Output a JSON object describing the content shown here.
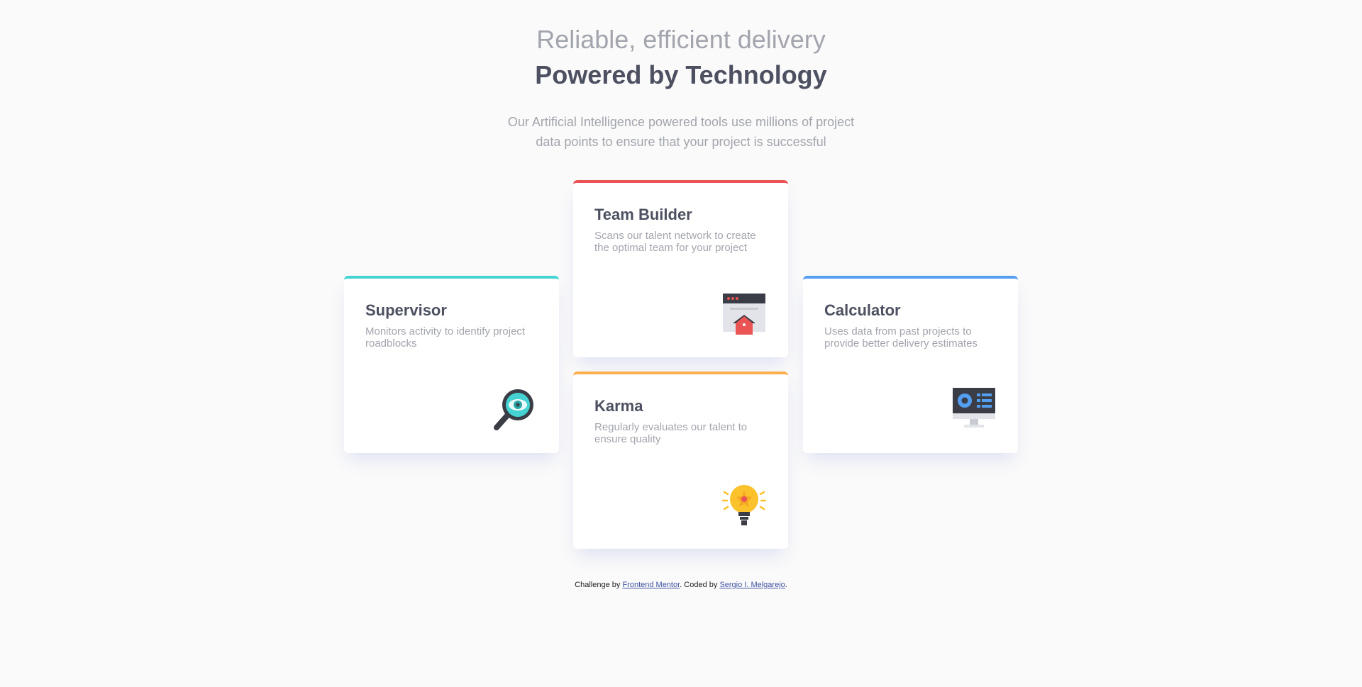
{
  "header": {
    "subtitle": "Reliable, efficient delivery",
    "title": "Powered by Technology",
    "intro": "Our Artificial Intelligence powered tools use millions of project data points to ensure that your project is successful"
  },
  "cards": {
    "supervisor": {
      "title": "Supervisor",
      "description": "Monitors activity to identify project roadblocks",
      "accent": "#44d3d2",
      "icon": "magnifier-eye-icon"
    },
    "team_builder": {
      "title": "Team Builder",
      "description": "Scans our talent network to create the optimal team for your project",
      "accent": "#ea5454",
      "icon": "browser-upload-icon"
    },
    "karma": {
      "title": "Karma",
      "description": "Regularly evaluates our talent to ensure quality",
      "accent": "#fcaf4a",
      "icon": "lightbulb-icon"
    },
    "calculator": {
      "title": "Calculator",
      "description": "Uses data from past projects to provide better delivery estimates",
      "accent": "#549ef2",
      "icon": "monitor-chart-icon"
    }
  },
  "footer": {
    "prefix": "Challenge by ",
    "challenge_link": "Frontend Mentor",
    "middle": ". Coded by ",
    "author_link": "Sergio I. Melgarejo",
    "suffix": "."
  }
}
